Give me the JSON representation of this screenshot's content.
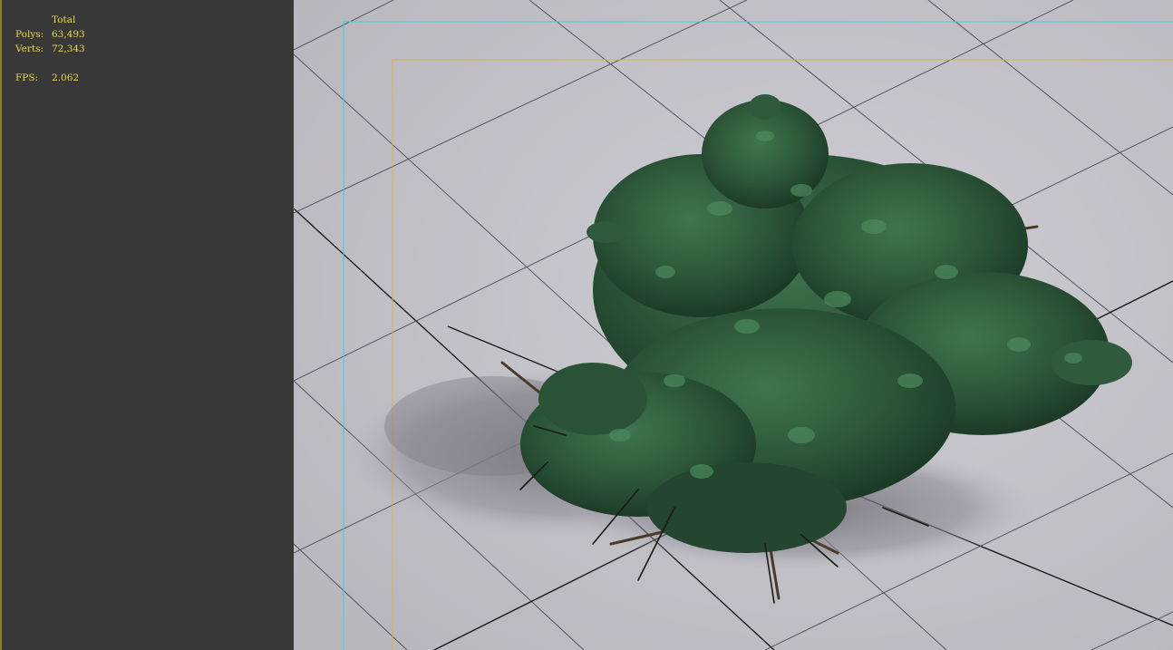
{
  "stats": {
    "title": "Total",
    "polys_label": "Polys:",
    "polys_value": "63,493",
    "verts_label": "Verts:",
    "verts_value": "72,343",
    "fps_label": "FPS:",
    "fps_value": "2.062"
  },
  "colors": {
    "panel_bg": "#383838",
    "stats_text": "#e8d84a",
    "viewport_bg": "#c7c5cc",
    "safe_frame": "#3ed0d8",
    "render_frame": "#d8b23a",
    "grid": "#4a4a52",
    "grid_axis": "#111111",
    "foliage": "#2f5a3c",
    "branch": "#4a3a28",
    "shadow": "#7a7880"
  },
  "viewport": {
    "object": "shrub-model"
  }
}
